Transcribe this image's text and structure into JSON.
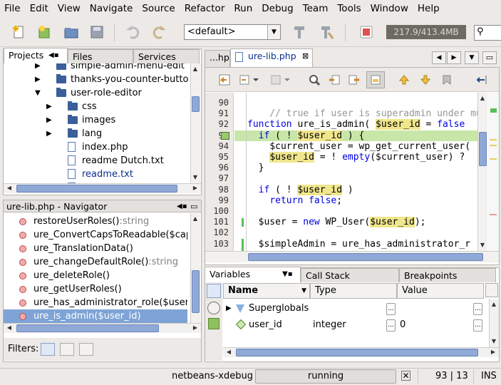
{
  "menu": [
    "File",
    "Edit",
    "View",
    "Navigate",
    "Source",
    "Refactor",
    "Run",
    "Debug",
    "Team",
    "Tools",
    "Window",
    "Help"
  ],
  "toolbar": {
    "config_value": "<default>",
    "memory": "217.9/413.4MB"
  },
  "projects_panel": {
    "tabs": [
      "Projects",
      "Files",
      "Services"
    ],
    "items": [
      {
        "label": "simple-admin-menu-edit",
        "type": "folder",
        "depth": 1
      },
      {
        "label": "thanks-you-counter-butto",
        "type": "folder",
        "depth": 1
      },
      {
        "label": "user-role-editor",
        "type": "project",
        "depth": 1,
        "expanded": true
      },
      {
        "label": "css",
        "type": "folder",
        "depth": 2
      },
      {
        "label": "images",
        "type": "folder",
        "depth": 2
      },
      {
        "label": "lang",
        "type": "folder",
        "depth": 2
      },
      {
        "label": "index.php",
        "type": "php",
        "depth": 2
      },
      {
        "label": "readme Dutch.txt",
        "type": "txt",
        "depth": 2
      },
      {
        "label": "readme.txt",
        "type": "txt",
        "depth": 2,
        "link": true
      },
      {
        "label": "",
        "type": "txt",
        "depth": 2
      }
    ]
  },
  "navigator": {
    "title": "ure-lib.php - Navigator",
    "items": [
      {
        "name": "restoreUserRoles()",
        "type": ":string"
      },
      {
        "name": "ure_ConvertCapsToReadable($cap",
        "type": ""
      },
      {
        "name": "ure_TranslationData()",
        "type": ""
      },
      {
        "name": "ure_changeDefaultRole()",
        "type": ":string"
      },
      {
        "name": "ure_deleteRole()",
        "type": ""
      },
      {
        "name": "ure_getUserRoles()",
        "type": ""
      },
      {
        "name": "ure_has_administrator_role($user",
        "type": ""
      },
      {
        "name": "ure_is_admin($user_id)",
        "type": "",
        "selected": true
      }
    ],
    "filters_label": "Filters:"
  },
  "editor": {
    "tabs": [
      "...hp",
      "ure-lib.php"
    ],
    "lines": [
      {
        "n": "90",
        "segs": [
          {
            "t": ""
          }
        ]
      },
      {
        "n": "91",
        "segs": [
          {
            "t": "    // true if user is superadmin under mult",
            "c": "cm"
          }
        ]
      },
      {
        "n": "92",
        "segs": [
          {
            "t": "function",
            "c": "kw"
          },
          {
            "t": " ure_is_admin( "
          },
          {
            "t": "$user_id",
            "c": "hl"
          },
          {
            "t": " = "
          },
          {
            "t": "false",
            "c": "kw"
          }
        ]
      },
      {
        "n": "93",
        "segs": [
          {
            "t": "  "
          },
          {
            "t": "if",
            "c": "kw"
          },
          {
            "t": " ( ! "
          },
          {
            "t": "$user_id",
            "c": "hl"
          },
          {
            "t": " ) {"
          }
        ],
        "current": true
      },
      {
        "n": "94",
        "segs": [
          {
            "t": "    $current_user = wp_get_current_user("
          }
        ]
      },
      {
        "n": "95",
        "segs": [
          {
            "t": "    "
          },
          {
            "t": "$user_id",
            "c": "hl"
          },
          {
            "t": " = ! "
          },
          {
            "t": "empty",
            "c": "kw"
          },
          {
            "t": "($current_user) ?"
          }
        ]
      },
      {
        "n": "96",
        "segs": [
          {
            "t": "  }"
          }
        ]
      },
      {
        "n": "97",
        "segs": [
          {
            "t": ""
          }
        ]
      },
      {
        "n": "98",
        "segs": [
          {
            "t": "  "
          },
          {
            "t": "if",
            "c": "kw"
          },
          {
            "t": " ( ! "
          },
          {
            "t": "$user_id",
            "c": "hl"
          },
          {
            "t": " )"
          }
        ]
      },
      {
        "n": "99",
        "segs": [
          {
            "t": "    "
          },
          {
            "t": "return",
            "c": "kw"
          },
          {
            "t": " "
          },
          {
            "t": "false",
            "c": "kw"
          },
          {
            "t": ";"
          }
        ]
      },
      {
        "n": "100",
        "segs": [
          {
            "t": ""
          }
        ]
      },
      {
        "n": "101",
        "segs": [
          {
            "t": "  $user = "
          },
          {
            "t": "new",
            "c": "kw"
          },
          {
            "t": " WP_User("
          },
          {
            "t": "$user_id",
            "c": "hl"
          },
          {
            "t": ");"
          }
        ]
      },
      {
        "n": "102",
        "segs": [
          {
            "t": ""
          }
        ]
      },
      {
        "n": "103",
        "segs": [
          {
            "t": "  $simpleAdmin = ure_has_administrator_r"
          }
        ]
      }
    ]
  },
  "debugger": {
    "tabs": [
      "Variables",
      "Call Stack",
      "Breakpoints"
    ],
    "columns": [
      "Name",
      "Type",
      "Value"
    ],
    "rows": [
      {
        "name": "Superglobals",
        "type": "",
        "value": ""
      },
      {
        "name": "user_id",
        "type": "integer",
        "value": "0"
      }
    ]
  },
  "status": {
    "session": "netbeans-xdebug",
    "state": "running",
    "position": "93 | 13",
    "mode": "INS"
  },
  "colors": {
    "current_line": "#c8e6a8",
    "selection": "#7ea3d6",
    "keyword": "#0000e6",
    "comment": "#969696",
    "highlight": "#f0e68c"
  }
}
